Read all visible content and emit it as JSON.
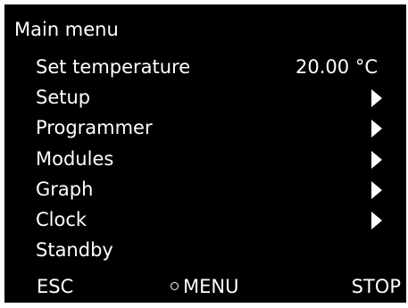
{
  "screen": {
    "title": "Main menu",
    "background_color": "#000000",
    "text_color": "#ffffff"
  },
  "menu": {
    "items": [
      {
        "label": "Set temperature",
        "value": "20.00 °C"
      },
      {
        "label": "Setup",
        "icon": "chevron-right-icon"
      },
      {
        "label": "Programmer",
        "icon": "chevron-right-icon"
      },
      {
        "label": "Modules",
        "icon": "chevron-right-icon"
      },
      {
        "label": "Graph",
        "icon": "chevron-right-icon"
      },
      {
        "label": "Clock",
        "icon": "chevron-right-icon"
      },
      {
        "label": "Standby"
      }
    ]
  },
  "softkeys": {
    "esc": "ESC",
    "menu": "MENU",
    "menu_icon": "circle-icon",
    "stop": "STOP"
  }
}
